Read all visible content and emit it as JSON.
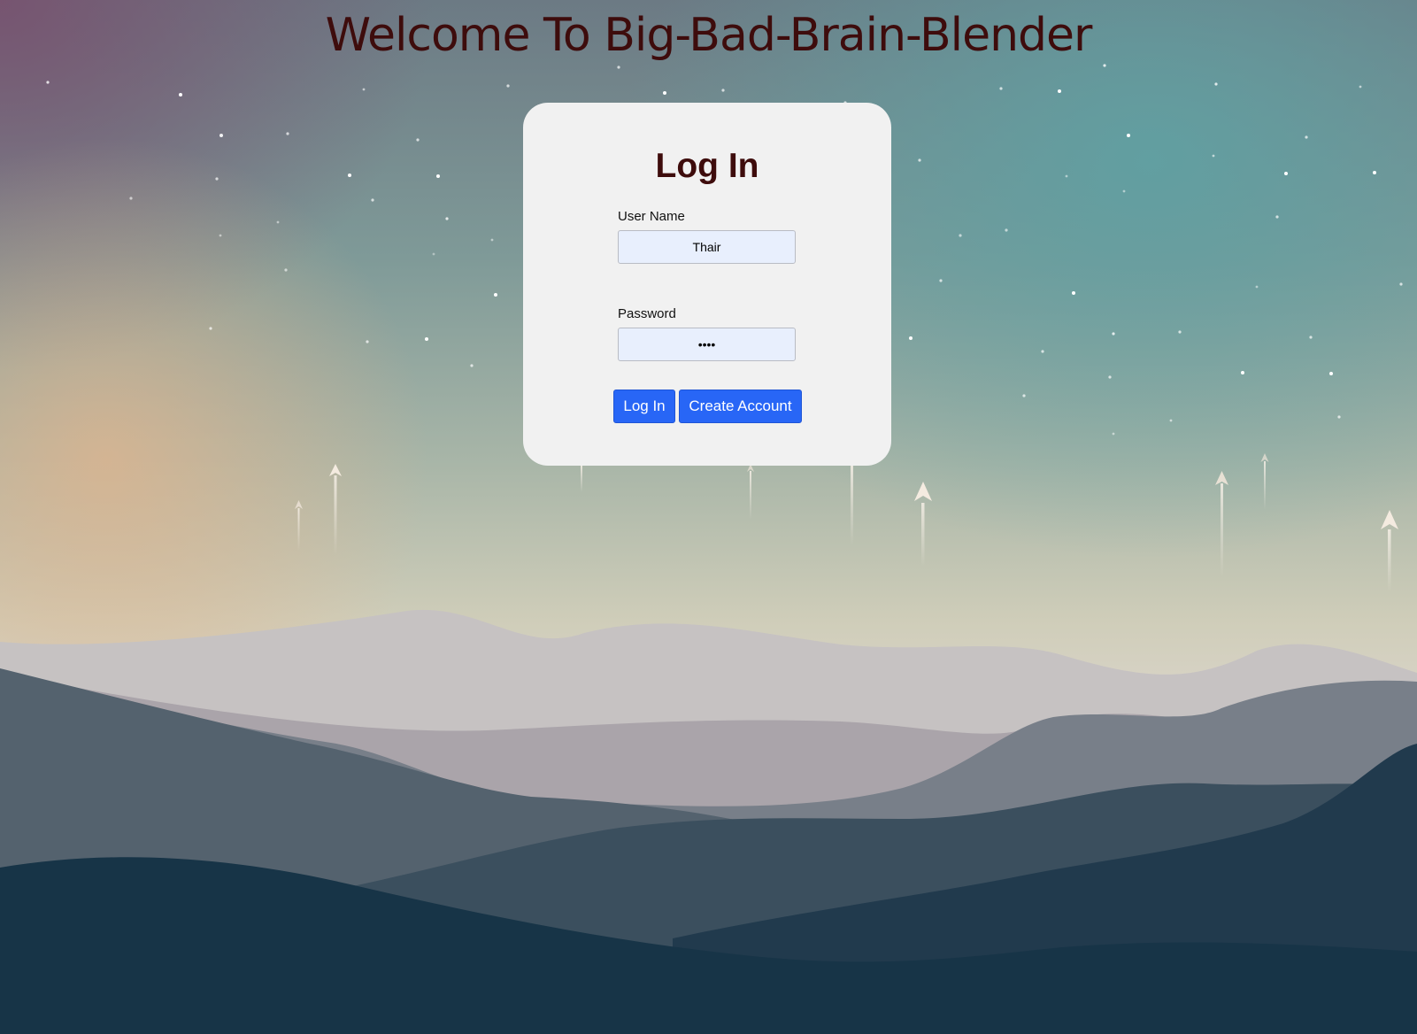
{
  "page": {
    "title": "Welcome To Big-Bad-Brain-Blender"
  },
  "login_form": {
    "heading": "Log In",
    "username": {
      "label": "User Name",
      "value": "Thair"
    },
    "password": {
      "label": "Password",
      "value": "••••"
    },
    "login_button_label": "Log In",
    "create_account_button_label": "Create Account"
  },
  "colors": {
    "title_color": "#3e0c0c",
    "button_blue": "#2866f6",
    "input_background": "#e8effd",
    "card_background": "#f1f1f1"
  }
}
